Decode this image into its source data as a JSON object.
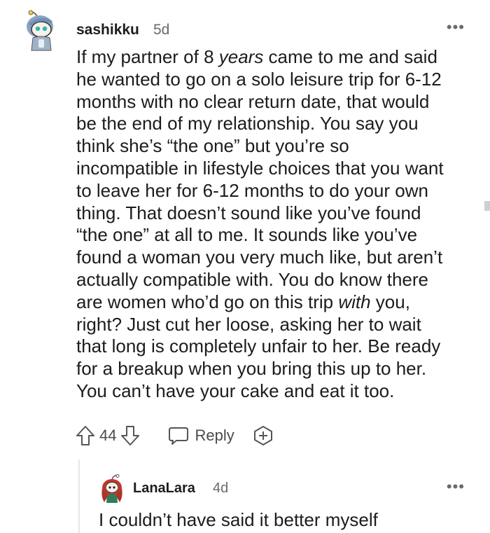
{
  "comment": {
    "username": "sashikku",
    "timestamp": "5d",
    "avatar_icon": "snoo-avatar-icon",
    "body_lines": [
      [
        {
          "t": "If my partner of 8 "
        },
        {
          "t": "years",
          "i": true
        },
        {
          "t": " came to me and said"
        }
      ],
      [
        {
          "t": "he wanted to go on a solo leisure trip for 6-12"
        }
      ],
      [
        {
          "t": "months with no clear return date, that would"
        }
      ],
      [
        {
          "t": "be the end of my relationship. You say you"
        }
      ],
      [
        {
          "t": "think she’s “the one” but you’re so"
        }
      ],
      [
        {
          "t": "incompatible in lifestyle choices that you want"
        }
      ],
      [
        {
          "t": "to leave her for 6-12 months to do your own"
        }
      ],
      [
        {
          "t": "thing. That doesn’t sound like you’ve found"
        }
      ],
      [
        {
          "t": "“the one” at all to me. It sounds like you’ve"
        }
      ],
      [
        {
          "t": "found a woman you very much like, but aren’t"
        }
      ],
      [
        {
          "t": "actually compatible with. You do know there"
        }
      ],
      [
        {
          "t": "are women who’d go on this trip "
        },
        {
          "t": "with",
          "i": true
        },
        {
          "t": " you,"
        }
      ],
      [
        {
          "t": "right? Just cut her loose, asking her to wait"
        }
      ],
      [
        {
          "t": "that long is completely unfair to her. Be ready"
        }
      ],
      [
        {
          "t": "for a breakup when you bring this up to her."
        }
      ],
      [
        {
          "t": "You can’t have your cake and eat it too."
        }
      ]
    ],
    "upvote_icon": "upvote-arrow-icon",
    "vote_count": "44",
    "downvote_icon": "downvote-arrow-icon",
    "reply_icon": "speech-bubble-icon",
    "reply_label": "Reply",
    "award_icon": "award-plus-icon",
    "more_label": "•••"
  },
  "reply": {
    "username": "LanaLara",
    "timestamp": "4d",
    "avatar_icon": "snoo-avatar-red-hair-icon",
    "body": "I couldn’t have said it better myself",
    "more_label": "•••"
  }
}
